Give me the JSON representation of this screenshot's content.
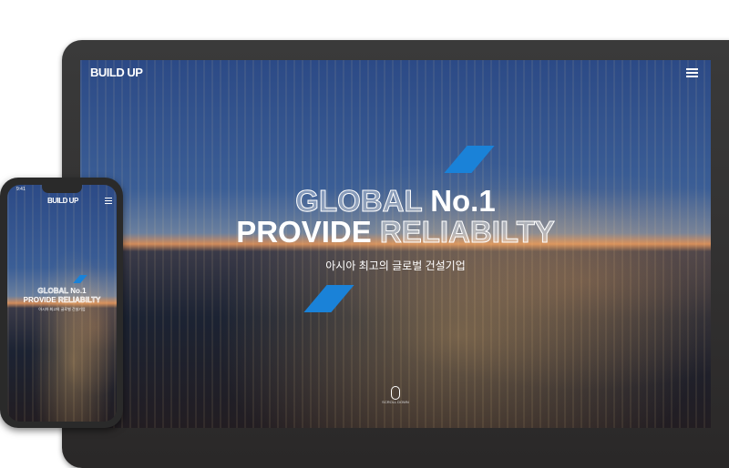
{
  "tablet": {
    "logo": "BUILD UP",
    "menu_icon": "hamburger-icon",
    "headline_line1_outline": "GLOBAL",
    "headline_line1_bold": "No.1",
    "headline_line2_bold": "PROVIDE",
    "headline_line2_outline": "RELIABILTY",
    "subtitle": "아시아 최고의 글로벌 건설기업",
    "scroll_label": "SCROLL DOWN",
    "accent": "#1a82d8"
  },
  "phone": {
    "time": "9:41",
    "logo": "BUILD UP",
    "headline_line1_outline": "GLOBAL",
    "headline_line1_bold": "No.1",
    "headline_line2_bold": "PROVIDE",
    "headline_line2_outline": "RELIABILTY",
    "subtitle": "아시아 최고의 글로벌 건설기업"
  }
}
